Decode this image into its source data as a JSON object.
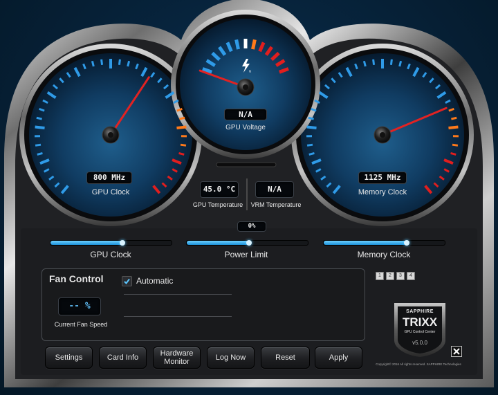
{
  "gauges": {
    "gpu_clock": {
      "readout": "800 MHz",
      "label": "GPU Clock",
      "needle_fraction": 0.62
    },
    "gpu_voltage": {
      "readout": "N/A",
      "label": "GPU Voltage",
      "needle_fraction": 0.0
    },
    "memory_clock": {
      "readout": "1125 MHz",
      "label": "Memory Clock",
      "needle_fraction": 0.74
    }
  },
  "temperatures": {
    "gpu": {
      "value": "45.0 °C",
      "label": "GPU Temperature"
    },
    "vrm": {
      "value": "N/A",
      "label": "VRM Temperature"
    }
  },
  "sliders": {
    "gpu_clock": {
      "label": "GPU Clock",
      "fraction": 0.59
    },
    "power_limit": {
      "label": "Power Limit",
      "value": "0%",
      "fraction": 0.51
    },
    "memory_clock": {
      "label": "Memory Clock",
      "fraction": 0.68
    }
  },
  "fan_control": {
    "title": "Fan Control",
    "automatic_label": "Automatic",
    "automatic_checked": true,
    "speed_value": "-- %",
    "speed_label": "Current Fan Speed"
  },
  "profiles": [
    "1",
    "2",
    "3",
    "4"
  ],
  "buttons": {
    "settings": "Settings",
    "card_info": "Card Info",
    "hardware_monitor": "Hardware\nMonitor",
    "log_now": "Log Now",
    "reset": "Reset",
    "apply": "Apply"
  },
  "logo": {
    "brand": "SAPPHIRE",
    "product": "TRIXX",
    "subtitle": "GPU Control Center",
    "version": "v5.0.0"
  },
  "copyright": "Copyright© 2016 All rights reserved. SAPPHIRE Technologies",
  "colors": {
    "accent_blue": "#2f9be8",
    "warn_orange": "#ff7a1a",
    "danger_red": "#e01e1e",
    "needle": "#e22222"
  },
  "icons": {
    "voltage": "lightning-bolt-icon",
    "close": "close-x-icon",
    "check": "checkmark-icon"
  }
}
